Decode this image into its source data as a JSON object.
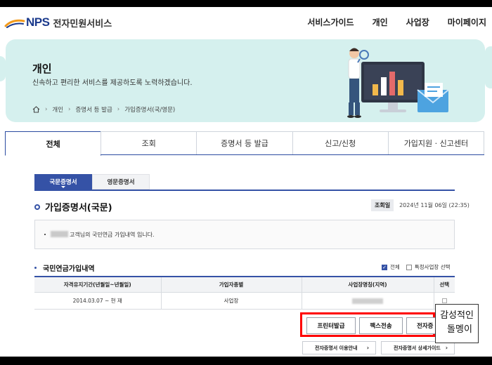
{
  "header": {
    "logo_text": "NPS",
    "site_title": "전자민원서비스",
    "nav": [
      "서비스가이드",
      "개인",
      "사업장",
      "마이페이지"
    ]
  },
  "hero": {
    "title": "개인",
    "description": "신속하고 편리한 서비스를 제공하도록 노력하겠습니다.",
    "breadcrumb": [
      "개인",
      "증명서 등 발급",
      "가입증명서(국/영문)"
    ]
  },
  "tabs": [
    {
      "label": "전체",
      "active": true
    },
    {
      "label": "조회",
      "active": false
    },
    {
      "label": "증명서 등 발급",
      "active": false
    },
    {
      "label": "신고/신청",
      "active": false
    },
    {
      "label": "가입지원 · 신고센터",
      "active": false
    }
  ],
  "subtabs": [
    {
      "label": "국문증명서",
      "active": true
    },
    {
      "label": "영문증명서",
      "active": false
    }
  ],
  "section": {
    "title": "가입증명서(국문)",
    "query_label": "조회일",
    "query_date": "2024년 11월 06일 (22:35)"
  },
  "info_text": "고객님의 국민연금 가입내역 입니다.",
  "history": {
    "title": "국민연금가입내역",
    "filter_all": "전체",
    "filter_all_checked": true,
    "filter_specific": "특정사업장 선택",
    "filter_specific_checked": false,
    "columns": [
      "자격유지기간(년월일~년월일)",
      "가입자종별",
      "사업장명칭(지역)",
      "선택"
    ],
    "rows": [
      {
        "period": "2014.03.07 ~ 현 재",
        "type": "사업장"
      }
    ]
  },
  "actions": {
    "print": "프린터발급",
    "fax": "팩스전송",
    "electronic": "전자증"
  },
  "guides": {
    "usage": "전자증명서 이용안내",
    "detail": "전자증명서 상세가이드"
  },
  "watermark": [
    "감성적인",
    "돌멩이"
  ],
  "colors": {
    "primary": "#3552a6",
    "hero_bg": "#d5f0ee",
    "highlight": "#ff0000"
  }
}
